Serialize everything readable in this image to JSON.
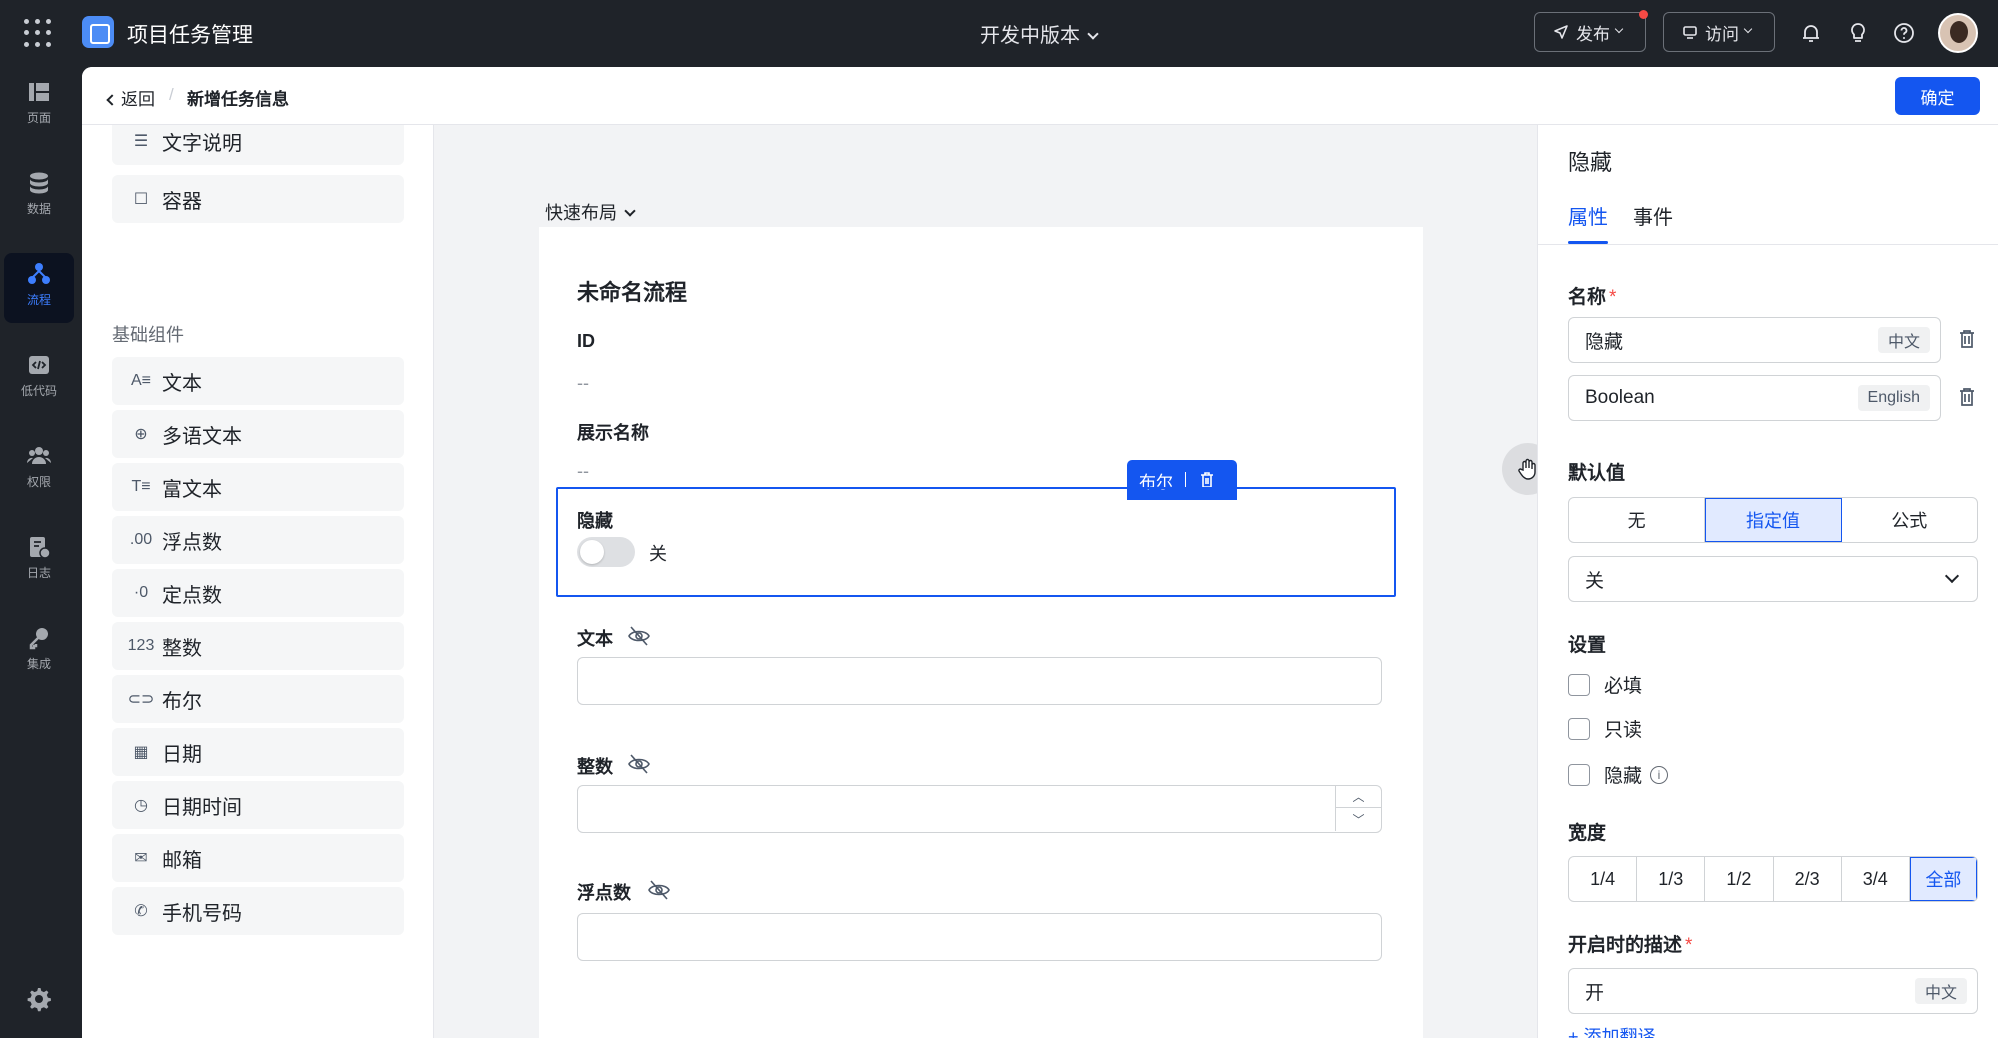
{
  "topbar": {
    "app_title": "项目任务管理",
    "version": "开发中版本",
    "publish_label": "发布",
    "visit_label": "访问"
  },
  "nav": [
    {
      "label": "页面",
      "icon": "pages-icon"
    },
    {
      "label": "数据",
      "icon": "database-icon"
    },
    {
      "label": "流程",
      "icon": "flow-icon",
      "active": true
    },
    {
      "label": "低代码",
      "icon": "code-icon"
    },
    {
      "label": "权限",
      "icon": "users-icon"
    },
    {
      "label": "日志",
      "icon": "log-icon"
    },
    {
      "label": "集成",
      "icon": "key-icon"
    }
  ],
  "subheader": {
    "back_label": "返回",
    "separator": "/",
    "current": "新增任务信息",
    "confirm_label": "确定"
  },
  "components": {
    "top_items": [
      "文字说明",
      "容器"
    ],
    "group_title": "基础组件",
    "items": [
      {
        "label": "文本",
        "glyph": "A≡"
      },
      {
        "label": "多语文本",
        "glyph": "⊕"
      },
      {
        "label": "富文本",
        "glyph": "T≡"
      },
      {
        "label": "浮点数",
        "glyph": ".00"
      },
      {
        "label": "定点数",
        "glyph": "·0"
      },
      {
        "label": "整数",
        "glyph": "123"
      },
      {
        "label": "布尔",
        "glyph": "⊂⊃"
      },
      {
        "label": "日期",
        "glyph": "▦"
      },
      {
        "label": "日期时间",
        "glyph": "◷"
      },
      {
        "label": "邮箱",
        "glyph": "✉"
      },
      {
        "label": "手机号码",
        "glyph": "✆"
      }
    ]
  },
  "canvas": {
    "quick_layout": "快速布局",
    "form_title": "未命名流程",
    "fields": {
      "id_label": "ID",
      "id_value": "--",
      "display_label": "展示名称",
      "display_value": "--",
      "hidden_label": "隐藏",
      "toggle_text": "关",
      "text_label": "文本",
      "int_label": "整数",
      "float_label": "浮点数"
    },
    "selection_tag": "布尔"
  },
  "props": {
    "title": "隐藏",
    "tabs": [
      "属性",
      "事件"
    ],
    "name_label": "名称",
    "required_mark": "*",
    "name_zh": "隐藏",
    "name_zh_badge": "中文",
    "name_en": "Boolean",
    "name_en_badge": "English",
    "default_label": "默认值",
    "default_options": [
      "无",
      "指定值",
      "公式"
    ],
    "default_selected": "指定值",
    "default_value": "关",
    "settings_label": "设置",
    "settings": [
      "必填",
      "只读",
      "隐藏"
    ],
    "width_label": "宽度",
    "width_options": [
      "1/4",
      "1/3",
      "1/2",
      "2/3",
      "3/4",
      "全部"
    ],
    "width_selected": "全部",
    "on_desc_label": "开启时的描述",
    "on_desc_value": "开",
    "on_desc_badge": "中文",
    "add_translation": "+ 添加翻译"
  },
  "colors": {
    "primary": "#1456f0",
    "dark_bg": "#1f2329",
    "danger": "#f54a45"
  }
}
